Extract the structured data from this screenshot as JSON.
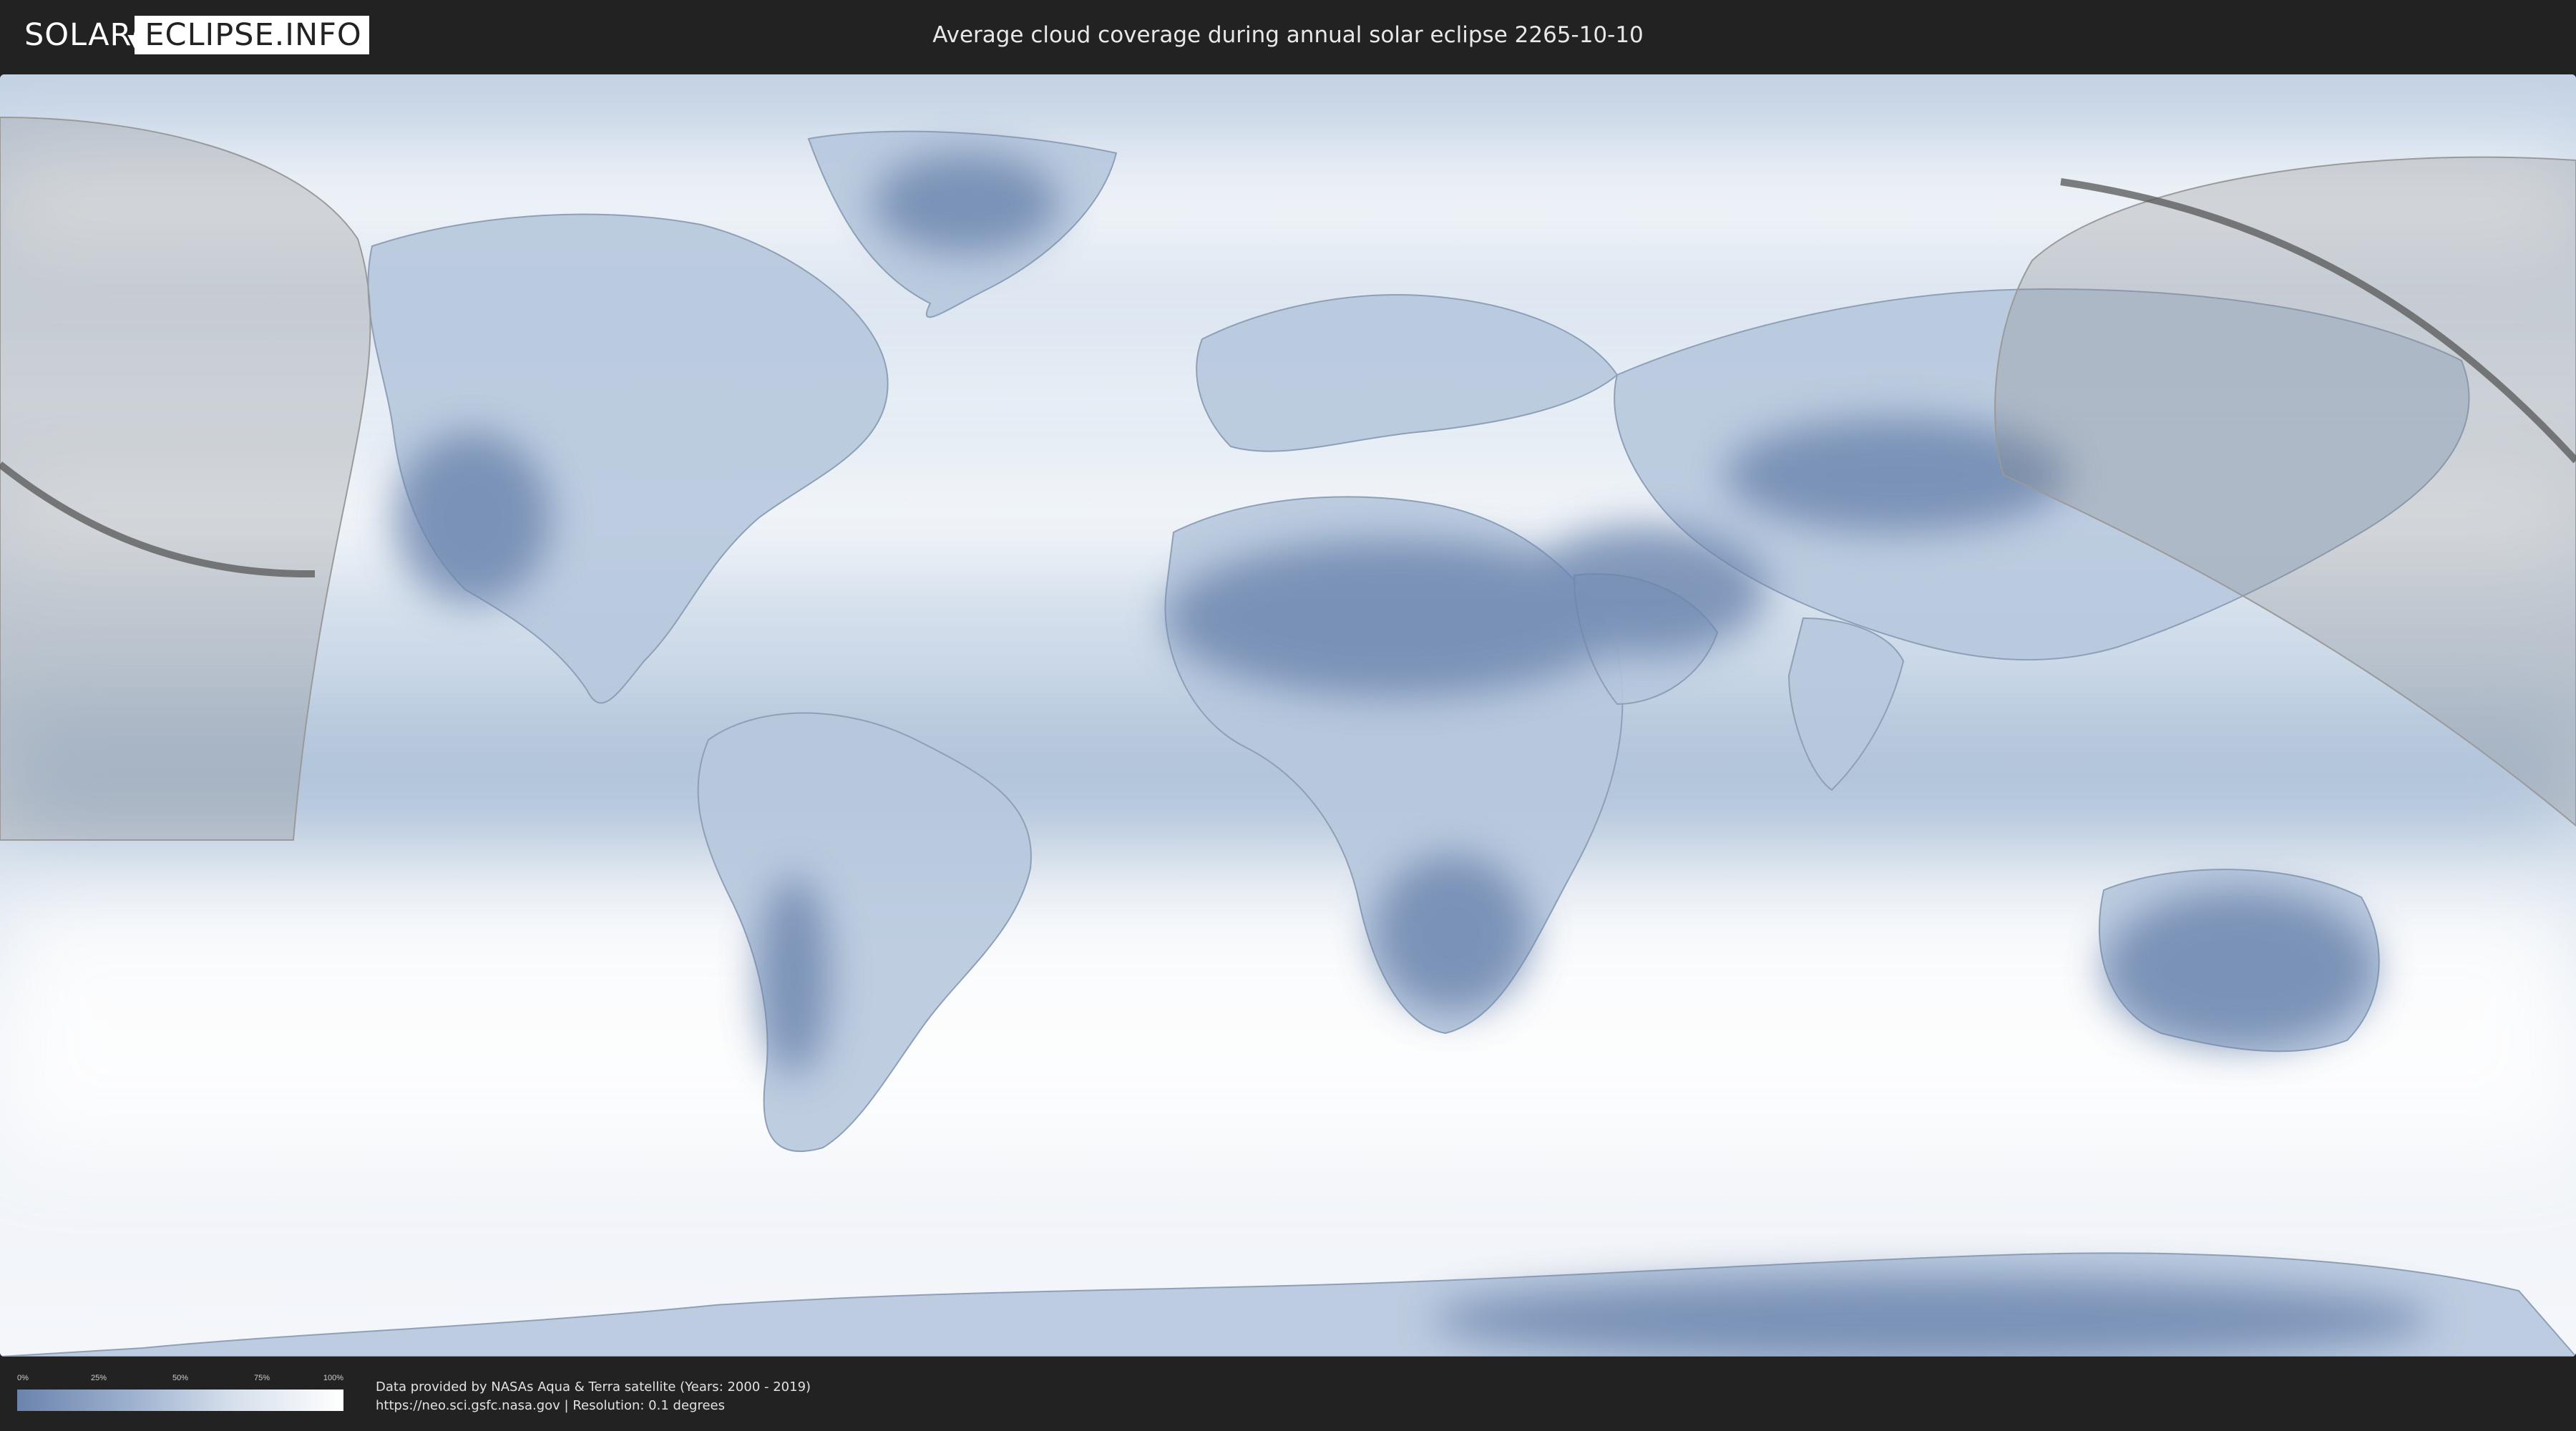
{
  "header": {
    "logo_left": "SOLAR",
    "logo_right": "ECLIPSE.INFO",
    "title": "Average cloud coverage during annual solar eclipse 2265-10-10"
  },
  "legend": {
    "ticks": [
      "0%",
      "25%",
      "50%",
      "75%",
      "100%"
    ],
    "values": [
      0,
      25,
      50,
      75,
      100
    ],
    "color_low": "#6b84ad",
    "color_high": "#ffffff"
  },
  "attribution": {
    "line1": "Data provided by NASAs Aqua & Terra satellite (Years: 2000 - 2019)",
    "line2": "https://neo.sci.gsfc.nasa.gov | Resolution: 0.1 degrees"
  },
  "map": {
    "projection": "equirectangular",
    "ocean_color": "#dce6f1",
    "clear_sky_color": "#6b84ad",
    "cloud_color": "#ffffff",
    "night_overlay_color": "#8a8a8a",
    "eclipse_path_color": "#555555"
  }
}
